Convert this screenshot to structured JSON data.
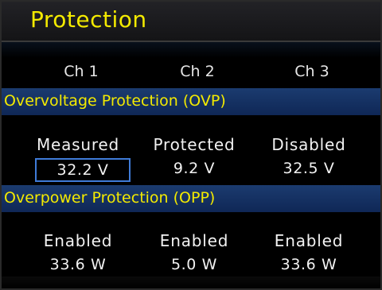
{
  "title": "Protection",
  "channels": [
    "Ch 1",
    "Ch 2",
    "Ch 3"
  ],
  "ovp": {
    "header": "Overvoltage Protection (OVP)",
    "states": [
      "Measured",
      "Protected",
      "Disabled"
    ],
    "values": [
      "32.2 V",
      "9.2 V",
      "32.5 V"
    ]
  },
  "opp": {
    "header": "Overpower Protection (OPP)",
    "states": [
      "Enabled",
      "Enabled",
      "Enabled"
    ],
    "values": [
      "33.6 W",
      "5.0 W",
      "33.6 W"
    ]
  },
  "colors": {
    "accent": "#f3ea00",
    "section_bg": "#1b3b6f",
    "selection_border": "#3f7bd8"
  }
}
